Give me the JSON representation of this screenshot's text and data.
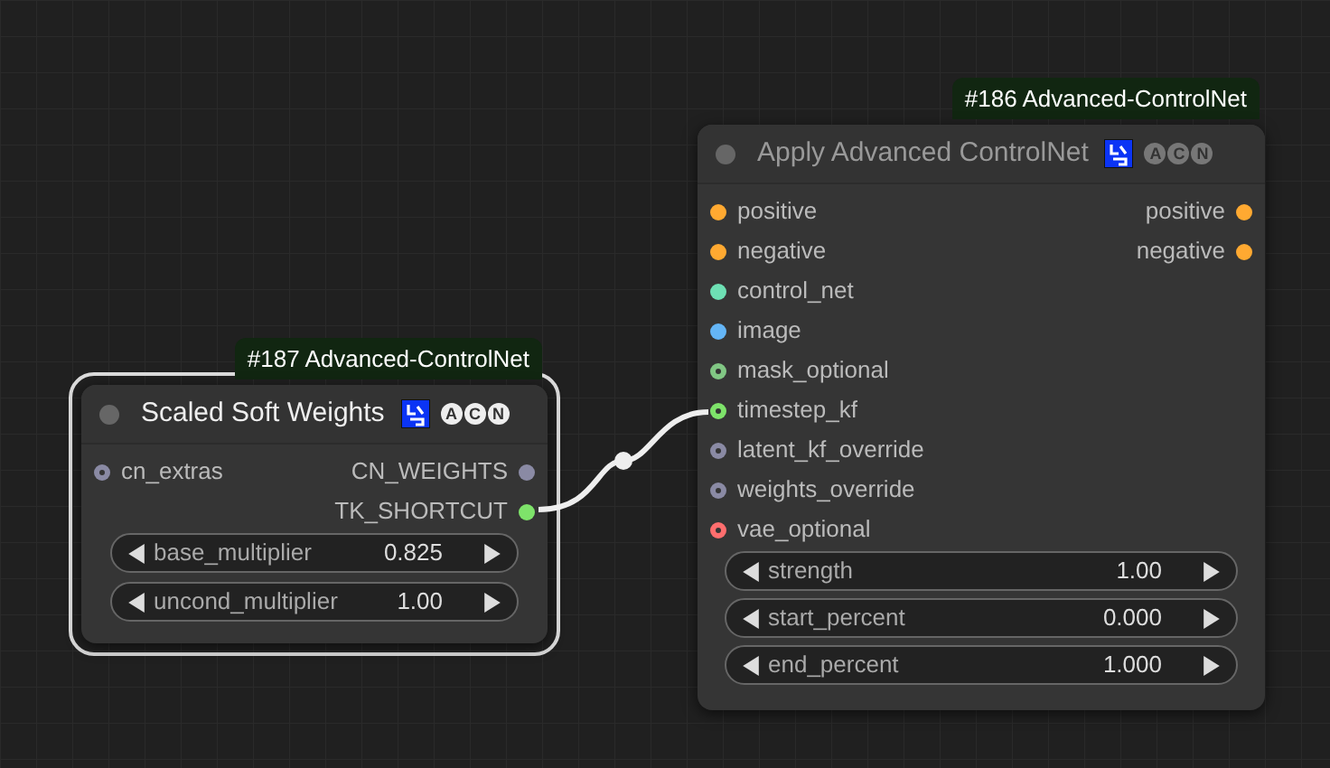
{
  "nodes": [
    {
      "badge": "#187 Advanced-ControlNet",
      "title": "Scaled Soft Weights",
      "selected": true,
      "badge_letters": [
        "A",
        "C",
        "N"
      ],
      "inputs": [
        {
          "name": "cn_extras",
          "color": "#8a8aa4",
          "optional": true
        }
      ],
      "outputs": [
        {
          "name": "CN_WEIGHTS",
          "color": "#8a8aa4",
          "optional": false
        },
        {
          "name": "TK_SHORTCUT",
          "color": "#7ee36a",
          "optional": false
        }
      ],
      "widgets": [
        {
          "name": "base_multiplier",
          "value": "0.825"
        },
        {
          "name": "uncond_multiplier",
          "value": "1.00"
        }
      ]
    },
    {
      "badge": "#186 Advanced-ControlNet",
      "title": "Apply Advanced ControlNet",
      "selected": false,
      "badge_letters": [
        "A",
        "C",
        "N"
      ],
      "inputs": [
        {
          "name": "positive",
          "color": "#ffa931",
          "optional": false
        },
        {
          "name": "negative",
          "color": "#ffa931",
          "optional": false
        },
        {
          "name": "control_net",
          "color": "#6ee0b4",
          "optional": false
        },
        {
          "name": "image",
          "color": "#64b5f6",
          "optional": false
        },
        {
          "name": "mask_optional",
          "color": "#81c784",
          "optional": true
        },
        {
          "name": "timestep_kf",
          "color": "#7ee36a",
          "optional": true
        },
        {
          "name": "latent_kf_override",
          "color": "#8a8aa4",
          "optional": true
        },
        {
          "name": "weights_override",
          "color": "#8a8aa4",
          "optional": true
        },
        {
          "name": "vae_optional",
          "color": "#ff6e6e",
          "optional": true
        }
      ],
      "outputs": [
        {
          "name": "positive",
          "color": "#ffa931",
          "optional": false
        },
        {
          "name": "negative",
          "color": "#ffa931",
          "optional": false
        }
      ],
      "widgets": [
        {
          "name": "strength",
          "value": "1.00"
        },
        {
          "name": "start_percent",
          "value": "0.000"
        },
        {
          "name": "end_percent",
          "value": "1.000"
        }
      ]
    }
  ]
}
